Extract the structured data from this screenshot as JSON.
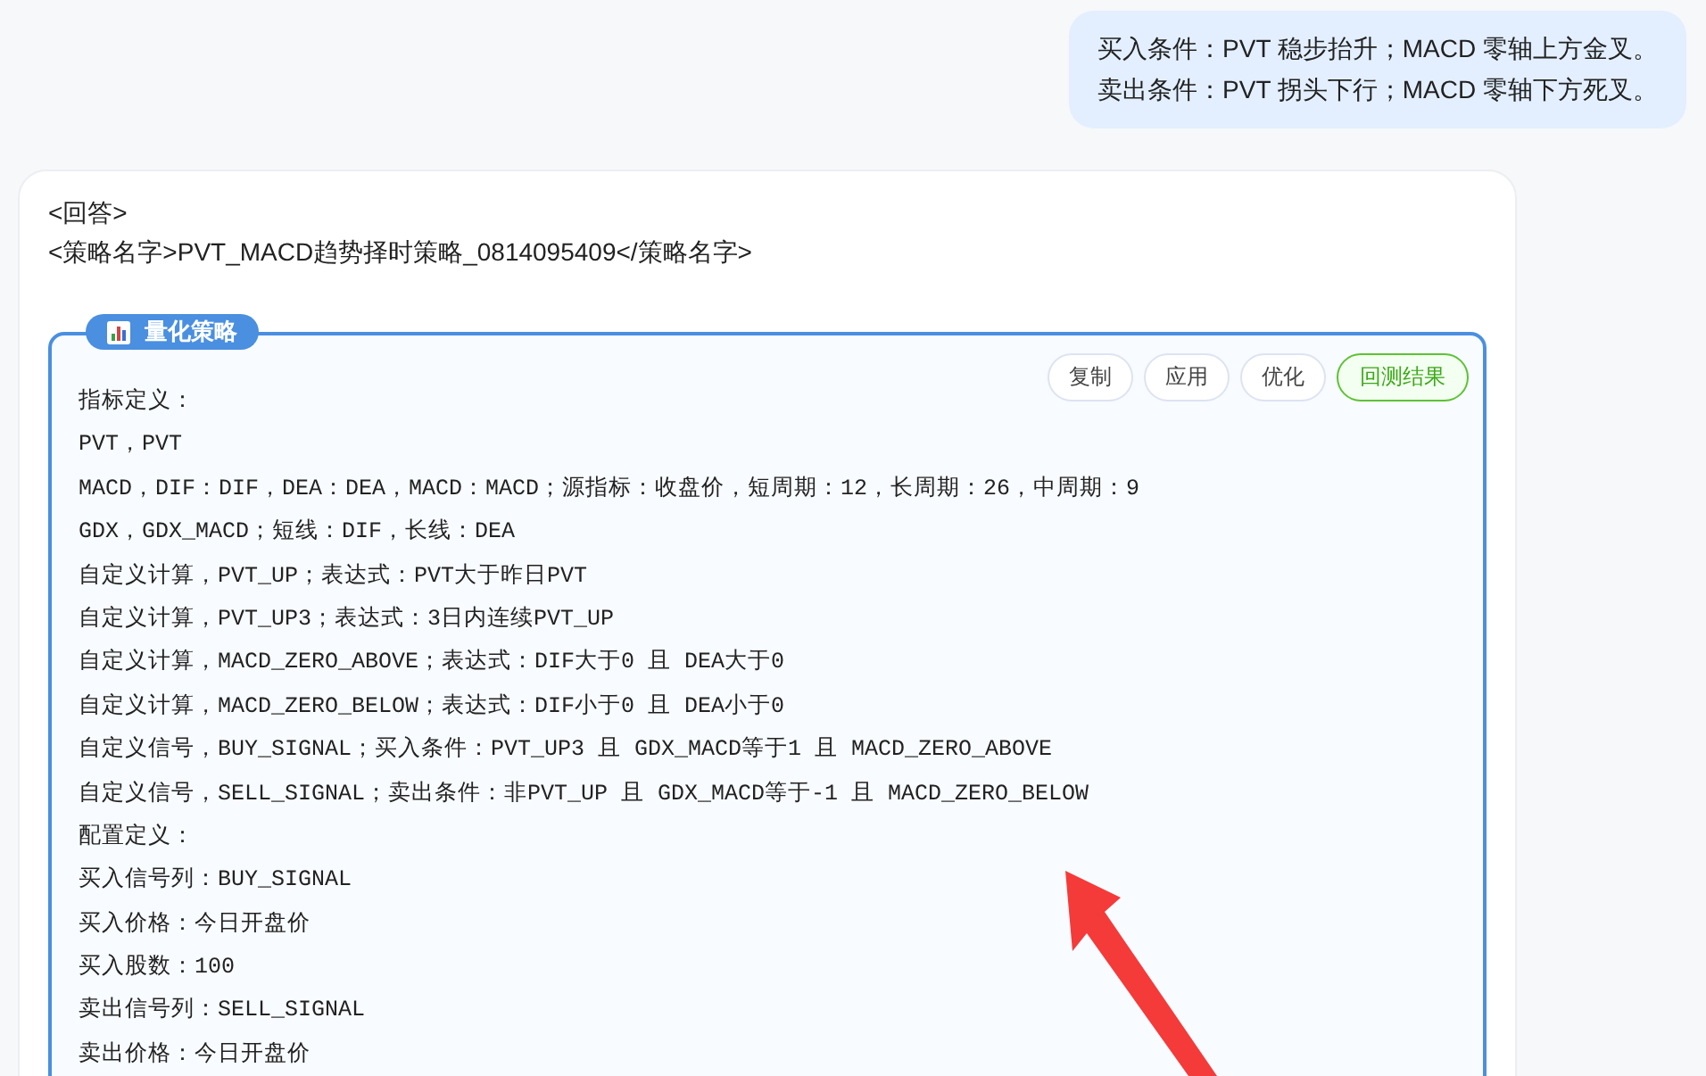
{
  "user_message": {
    "lines": [
      "买入条件：PVT 稳步抬升；MACD 零轴上方金叉。",
      "卖出条件：PVT 拐头下行；MACD 零轴下方死叉。"
    ]
  },
  "reply": {
    "header_lines": [
      "<回答>",
      "<策略名字>PVT_MACD趋势择时策略_0814095409</策略名字>"
    ],
    "strategy_panel": {
      "badge": "量化策略",
      "buttons": [
        {
          "label": "复制",
          "kind": "plain"
        },
        {
          "label": "应用",
          "kind": "plain"
        },
        {
          "label": "优化",
          "kind": "plain"
        },
        {
          "label": "回测结果",
          "kind": "success"
        }
      ],
      "code_lines": [
        "指标定义：",
        "PVT，PVT",
        "MACD，DIF：DIF，DEA：DEA，MACD：MACD；源指标：收盘价，短周期：12，长周期：26，中周期：9",
        "GDX，GDX_MACD；短线：DIF，长线：DEA",
        "自定义计算，PVT_UP；表达式：PVT大于昨日PVT",
        "自定义计算，PVT_UP3；表达式：3日内连续PVT_UP",
        "自定义计算，MACD_ZERO_ABOVE；表达式：DIF大于0 且 DEA大于0",
        "自定义计算，MACD_ZERO_BELOW；表达式：DIF小于0 且 DEA小于0",
        "自定义信号，BUY_SIGNAL；买入条件：PVT_UP3 且 GDX_MACD等于1 且 MACD_ZERO_ABOVE",
        "自定义信号，SELL_SIGNAL；卖出条件：非PVT_UP 且 GDX_MACD等于-1 且 MACD_ZERO_BELOW",
        "配置定义：",
        "买入信号列：BUY_SIGNAL",
        "买入价格：今日开盘价",
        "买入股数：100",
        "卖出信号列：SELL_SIGNAL",
        "卖出价格：今日开盘价"
      ]
    }
  }
}
